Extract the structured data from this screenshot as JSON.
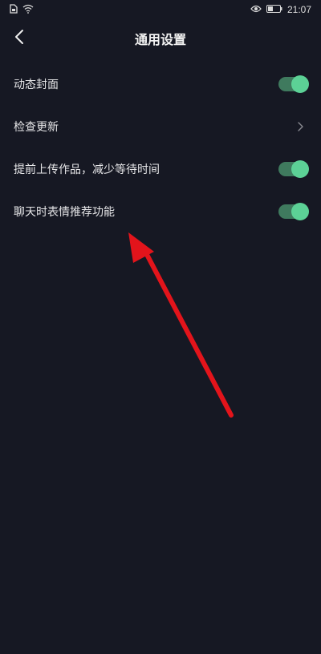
{
  "status_bar": {
    "time": "21:07",
    "icons": [
      "sim-icon",
      "wifi-icon",
      "eye-icon",
      "battery-icon"
    ]
  },
  "header": {
    "title": "通用设置",
    "back_icon": "chevron-left-icon"
  },
  "settings": [
    {
      "label": "动态封面",
      "control": "toggle",
      "state": "on"
    },
    {
      "label": "检查更新",
      "control": "chevron",
      "state": ""
    },
    {
      "label": "提前上传作品，减少等待时间",
      "control": "toggle",
      "state": "on"
    },
    {
      "label": "聊天时表情推荐功能",
      "control": "toggle",
      "state": "on"
    }
  ],
  "colors": {
    "background": "#161823",
    "toggle_track": "#3f7a5e",
    "toggle_knob": "#5cd196",
    "annotation_arrow": "#e3141b"
  }
}
